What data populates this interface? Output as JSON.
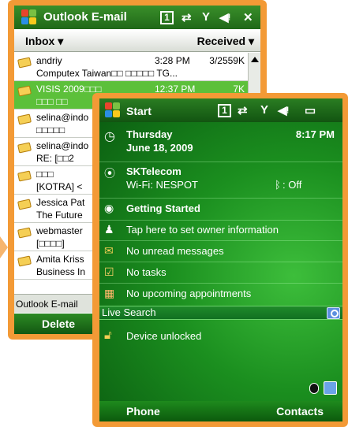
{
  "outlook": {
    "title": "Outlook E-mail",
    "folder": "Inbox ▾",
    "sort": "Received ▾",
    "messages": [
      {
        "from": "andriy",
        "time": "3:28 PM",
        "size": "3/2559K",
        "subject": "Computex Taiwan□□ □□□□□ TG..."
      },
      {
        "from": "VISIS 2009□□□",
        "time": "12:37 PM",
        "size": "7K",
        "subject": "□□□ □□"
      },
      {
        "from": "selina@indo",
        "time": "",
        "size": "",
        "subject": "□□□□□"
      },
      {
        "from": "selina@indo",
        "time": "",
        "size": "",
        "subject": "RE: [□□2"
      },
      {
        "from": "□□□",
        "time": "",
        "size": "",
        "subject": "[KOTRA] <"
      },
      {
        "from": "Jessica Pat",
        "time": "",
        "size": "",
        "subject": "The Future"
      },
      {
        "from": "webmaster",
        "time": "",
        "size": "",
        "subject": "[□□□□]"
      },
      {
        "from": "Amita Kriss",
        "time": "",
        "size": "",
        "subject": "Business In"
      }
    ],
    "status": "Outlook E-mail",
    "softkey_left": "Delete"
  },
  "today": {
    "title": "Start",
    "day": "Thursday",
    "date": "June 18, 2009",
    "clock": "8:17 PM",
    "operator": "SKTelecom",
    "wifi": "Wi-Fi: NESPOT",
    "bluetooth": ": Off",
    "getting_started": "Getting Started",
    "owner_info": "Tap here to set owner information",
    "messages": "No unread messages",
    "tasks": "No tasks",
    "appointments": "No upcoming appointments",
    "live_search": "Live Search",
    "device_lock": "Device unlocked",
    "softkey_left": "Phone",
    "softkey_right": "Contacts"
  },
  "colors": {
    "frame": "#f39a36",
    "title_green": "#1f6818",
    "selected_row": "#5cc03a",
    "today_green": "#1b8f1f"
  },
  "icons": [
    "windows-flag-icon",
    "signal-icon",
    "volume-icon",
    "close-icon",
    "clock-icon",
    "phone-icon",
    "getting-started-icon",
    "owner-icon",
    "mail-icon",
    "task-icon",
    "calendar-icon",
    "lock-icon",
    "search-icon",
    "bluetooth-icon"
  ]
}
